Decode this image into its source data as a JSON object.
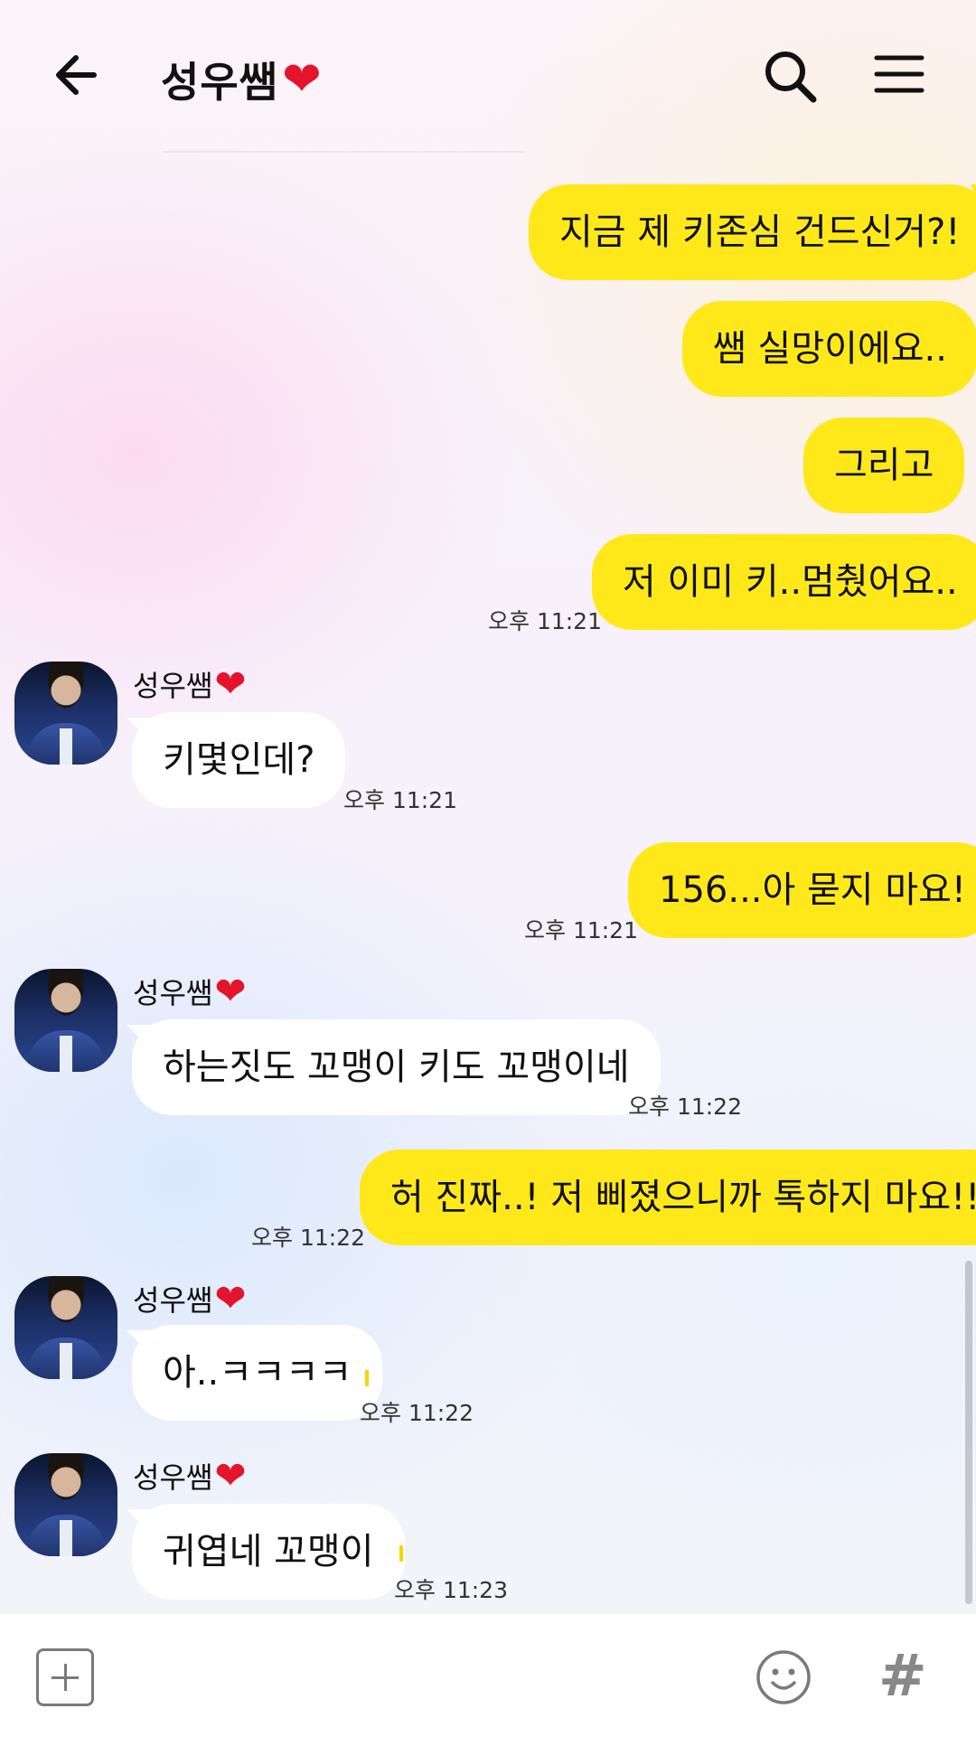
{
  "header": {
    "title": "성우쌤",
    "title_heart": "❤"
  },
  "messages": [
    {
      "side": "me",
      "text": "지금 제 키존심 건드신거?!"
    },
    {
      "side": "me",
      "text": "쌤 실망이에요.."
    },
    {
      "side": "me",
      "text": "그리고"
    },
    {
      "side": "me",
      "text": "저 이미 키..멈췄어요..",
      "time": "오후 11:21"
    },
    {
      "side": "them",
      "sender": "성우쌤",
      "text": "키몇인데?",
      "time": "오후 11:21"
    },
    {
      "side": "me",
      "text": "156...아 묻지 마요!",
      "time": "오후 11:21"
    },
    {
      "side": "them",
      "sender": "성우쌤",
      "text": "하는짓도 꼬맹이 키도 꼬맹이네",
      "time": "오후 11:22"
    },
    {
      "side": "me",
      "text": "허 진짜..! 저 삐졌으니까 톡하지 마요!!",
      "time": "오후 11:22"
    },
    {
      "side": "them",
      "sender": "성우쌤",
      "text": "아..ㅋㅋㅋㅋ",
      "time": "오후 11:22"
    },
    {
      "side": "them",
      "sender": "성우쌤",
      "text": "귀엽네 꼬맹이",
      "time": "오후 11:23"
    }
  ],
  "sender_heart": "❤",
  "bottom": {
    "hash": "#"
  },
  "colors": {
    "my_bubble": "#ffe81a",
    "their_bubble": "#ffffff",
    "heart": "#e3142c",
    "unread_marker": "#f7d500"
  },
  "icons": [
    "back-arrow-icon",
    "search-icon",
    "menu-icon",
    "plus-icon",
    "emoji-icon",
    "hash-icon"
  ]
}
